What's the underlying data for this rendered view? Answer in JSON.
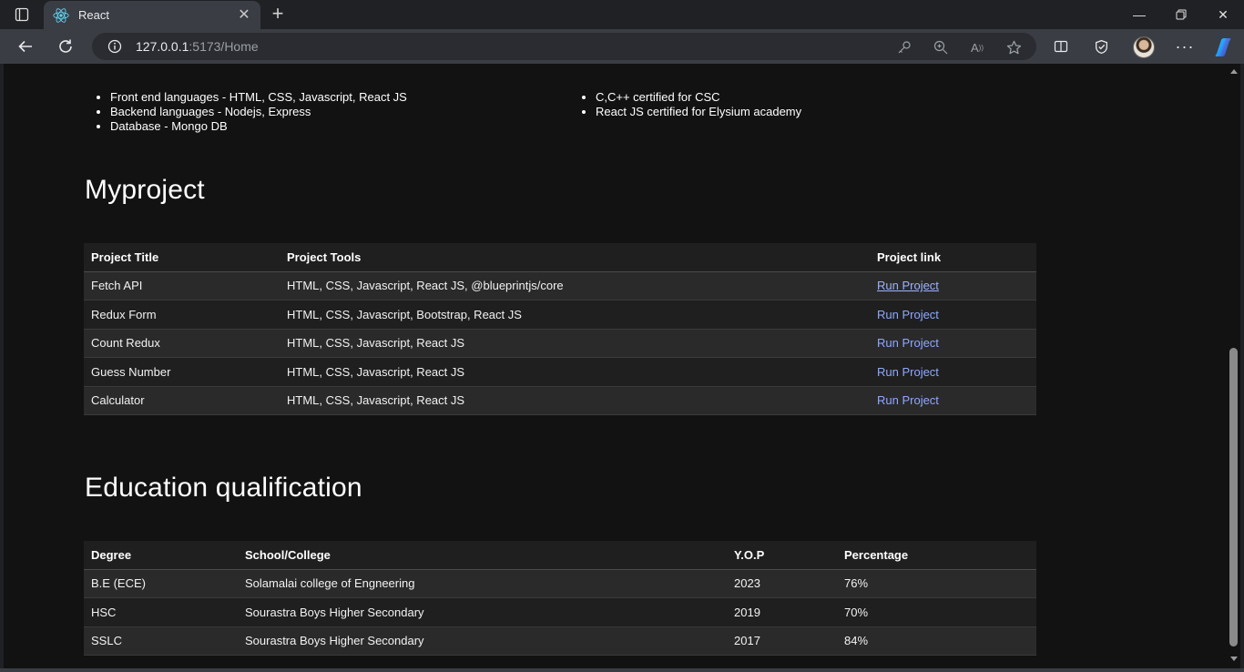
{
  "browser": {
    "tab_title": "React",
    "url_host": "127.0.0.1",
    "url_rest": ":5173/Home"
  },
  "skills": [
    "Front end languages - HTML, CSS, Javascript, React JS",
    "Backend languages - Nodejs, Express",
    "Database - Mongo DB"
  ],
  "certifications": [
    "C,C++ certified for CSC",
    "React JS certified for Elysium academy"
  ],
  "projects": {
    "heading": "Myproject",
    "headers": [
      "Project Title",
      "Project Tools",
      "Project link"
    ],
    "rows": [
      {
        "title": "Fetch API",
        "tools": "HTML, CSS, Javascript, React JS, @blueprintjs/core",
        "link": "Run Project"
      },
      {
        "title": "Redux Form",
        "tools": "HTML, CSS, Javascript, Bootstrap, React JS",
        "link": "Run Project"
      },
      {
        "title": "Count Redux",
        "tools": "HTML, CSS, Javascript, React JS",
        "link": "Run Project"
      },
      {
        "title": "Guess Number",
        "tools": "HTML, CSS, Javascript, React JS",
        "link": "Run Project"
      },
      {
        "title": "Calculator",
        "tools": "HTML, CSS, Javascript, React JS",
        "link": "Run Project"
      }
    ]
  },
  "education": {
    "heading": "Education qualification",
    "headers": [
      "Degree",
      "School/College",
      "Y.O.P",
      "Percentage"
    ],
    "rows": [
      {
        "degree": "B.E (ECE)",
        "school": "Solamalai college of Engneering",
        "yop": "2023",
        "percentage": "76%"
      },
      {
        "degree": "HSC",
        "school": "Sourastra Boys Higher Secondary",
        "yop": "2019",
        "percentage": "70%"
      },
      {
        "degree": "SSLC",
        "school": "Sourastra Boys Higher Secondary",
        "yop": "2017",
        "percentage": "84%"
      }
    ]
  },
  "colors": {
    "page_bg": "#121212",
    "link": "#8ea8ff",
    "browser_chrome": "#3b3d44"
  }
}
